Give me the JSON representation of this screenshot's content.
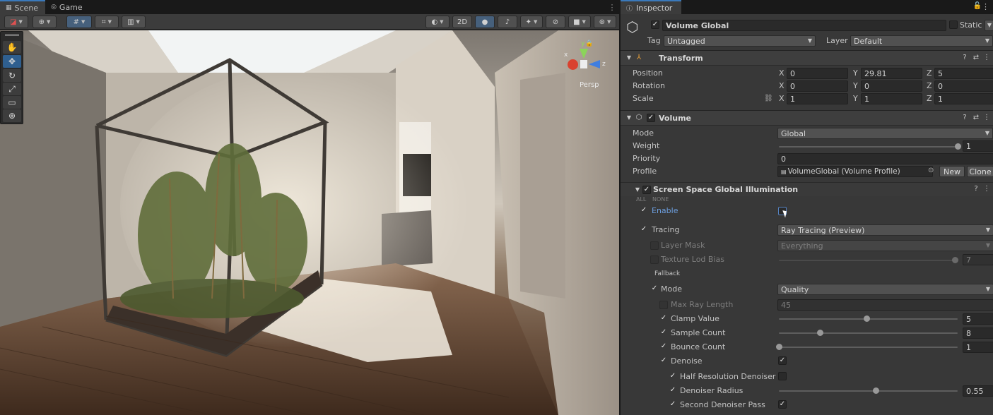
{
  "scene_tabs": {
    "scene": "Scene",
    "game": "Game"
  },
  "scene_toolbar": {
    "mode_2d": "2D"
  },
  "gizmo": {
    "label": "Persp",
    "x_label": "x",
    "y_label": "y",
    "z_label": "z"
  },
  "inspector": {
    "tab": "Inspector",
    "object": {
      "name": "Volume Global",
      "static_label": "Static",
      "tag_label": "Tag",
      "tag_value": "Untagged",
      "layer_label": "Layer",
      "layer_value": "Default"
    },
    "transform": {
      "title": "Transform",
      "rows": [
        {
          "label": "Position",
          "x": "0",
          "y": "29.81",
          "z": "5"
        },
        {
          "label": "Rotation",
          "x": "0",
          "y": "0",
          "z": "0"
        },
        {
          "label": "Scale",
          "x": "1",
          "y": "1",
          "z": "1"
        }
      ],
      "axis": {
        "x": "X",
        "y": "Y",
        "z": "Z"
      }
    },
    "volume": {
      "title": "Volume",
      "mode_label": "Mode",
      "mode_value": "Global",
      "weight_label": "Weight",
      "weight_value": "1",
      "weight_fraction": 1.0,
      "priority_label": "Priority",
      "priority_value": "0",
      "profile_label": "Profile",
      "profile_value": "VolumeGlobal (Volume Profile)",
      "new_label": "New",
      "clone_label": "Clone"
    },
    "ssgi": {
      "title": "Screen Space Global Illumination",
      "all": "ALL",
      "none": "NONE",
      "enable_label": "Enable",
      "tracing_label": "Tracing",
      "tracing_value": "Ray Tracing (Preview)",
      "layer_mask_label": "Layer Mask",
      "layer_mask_value": "Everything",
      "texture_lod_label": "Texture Lod Bias",
      "texture_lod_value": "7",
      "texture_lod_fraction": 0.985,
      "fallback_label": "Fallback",
      "mode_label": "Mode",
      "mode_value": "Quality",
      "max_ray_label": "Max Ray Length",
      "max_ray_value": "45",
      "clamp_label": "Clamp Value",
      "clamp_value": "5",
      "clamp_fraction": 0.49,
      "sample_label": "Sample Count",
      "sample_value": "8",
      "sample_fraction": 0.23,
      "bounce_label": "Bounce Count",
      "bounce_value": "1",
      "bounce_fraction": 0.0,
      "denoise_label": "Denoise",
      "half_res_label": "Half Resolution Denoiser",
      "radius_label": "Denoiser Radius",
      "radius_value": "0.55",
      "radius_fraction": 0.54,
      "second_pass_label": "Second Denoiser Pass"
    }
  },
  "icons": [
    "scene-icon",
    "game-icon",
    "hand-icon",
    "move-icon",
    "rotate-icon",
    "scale-icon",
    "rect-icon",
    "transform-icon",
    "help-icon",
    "preset-icon",
    "kebab-icon",
    "cube-icon",
    "lock-icon",
    "link-icon",
    "target-icon"
  ]
}
